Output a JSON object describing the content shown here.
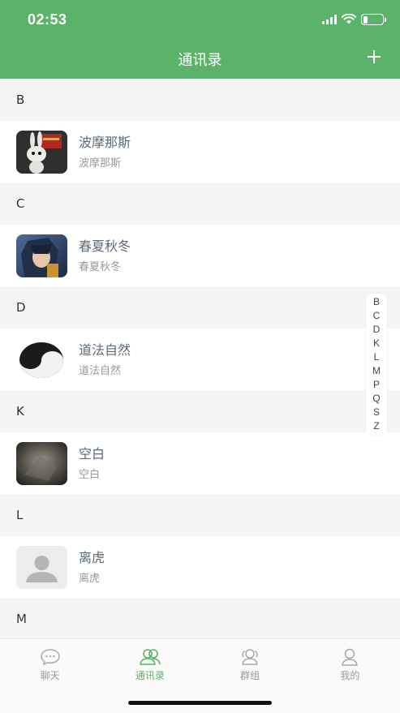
{
  "status_bar": {
    "time": "02:53",
    "battery_level": 0.25
  },
  "nav": {
    "title": "通讯录",
    "add_icon": "plus-icon"
  },
  "sections": [
    {
      "letter": "B",
      "contacts": [
        {
          "name": "波摩那斯",
          "sub": "波摩那斯",
          "avatar": "rabbit-avatar"
        }
      ]
    },
    {
      "letter": "C",
      "contacts": [
        {
          "name": "春夏秋冬",
          "sub": "春夏秋冬",
          "avatar": "anime-avatar"
        }
      ]
    },
    {
      "letter": "D",
      "contacts": [
        {
          "name": "道法自然",
          "sub": "道法自然",
          "avatar": "yin-yang-avatar"
        }
      ]
    },
    {
      "letter": "K",
      "contacts": [
        {
          "name": "空白",
          "sub": "空白",
          "avatar": "dark-photo-avatar"
        }
      ]
    },
    {
      "letter": "L",
      "contacts": [
        {
          "name": "离虎",
          "sub": "离虎",
          "avatar": "default-person-avatar"
        }
      ]
    },
    {
      "letter": "M",
      "contacts": []
    }
  ],
  "index_letters": [
    "B",
    "C",
    "D",
    "K",
    "L",
    "M",
    "P",
    "Q",
    "S",
    "Z"
  ],
  "tabs": [
    {
      "label": "聊天",
      "icon": "chat-icon",
      "active": false
    },
    {
      "label": "通讯录",
      "icon": "contacts-icon",
      "active": true
    },
    {
      "label": "群组",
      "icon": "group-icon",
      "active": false
    },
    {
      "label": "我的",
      "icon": "profile-icon",
      "active": false
    }
  ],
  "colors": {
    "brand": "#5bb36b",
    "background": "#f5f5f5",
    "name_text": "#5a6a7a",
    "tab_inactive": "#999999"
  }
}
